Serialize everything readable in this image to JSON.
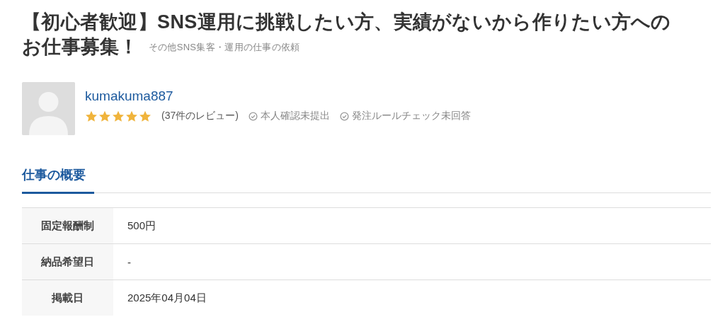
{
  "title_lines": [
    "【初心者歓迎】SNS運用に挑戦したい方、実績がないから作りたい方への",
    "お仕事募集！"
  ],
  "category": "その他SNS集客・運用の仕事の依頼",
  "client": {
    "name": "kumakuma887",
    "stars": 5,
    "reviews": "(37件のレビュー)",
    "badges": [
      {
        "label": "本人確認未提出"
      },
      {
        "label": "発注ルールチェック未回答"
      }
    ]
  },
  "tabs": [
    {
      "label": "仕事の概要",
      "selected": true
    }
  ],
  "details": [
    {
      "label": "固定報酬制",
      "value": "500円"
    },
    {
      "label": "納品希望日",
      "value": "-"
    },
    {
      "label": "掲載日",
      "value": "2025年04月04日"
    }
  ]
}
